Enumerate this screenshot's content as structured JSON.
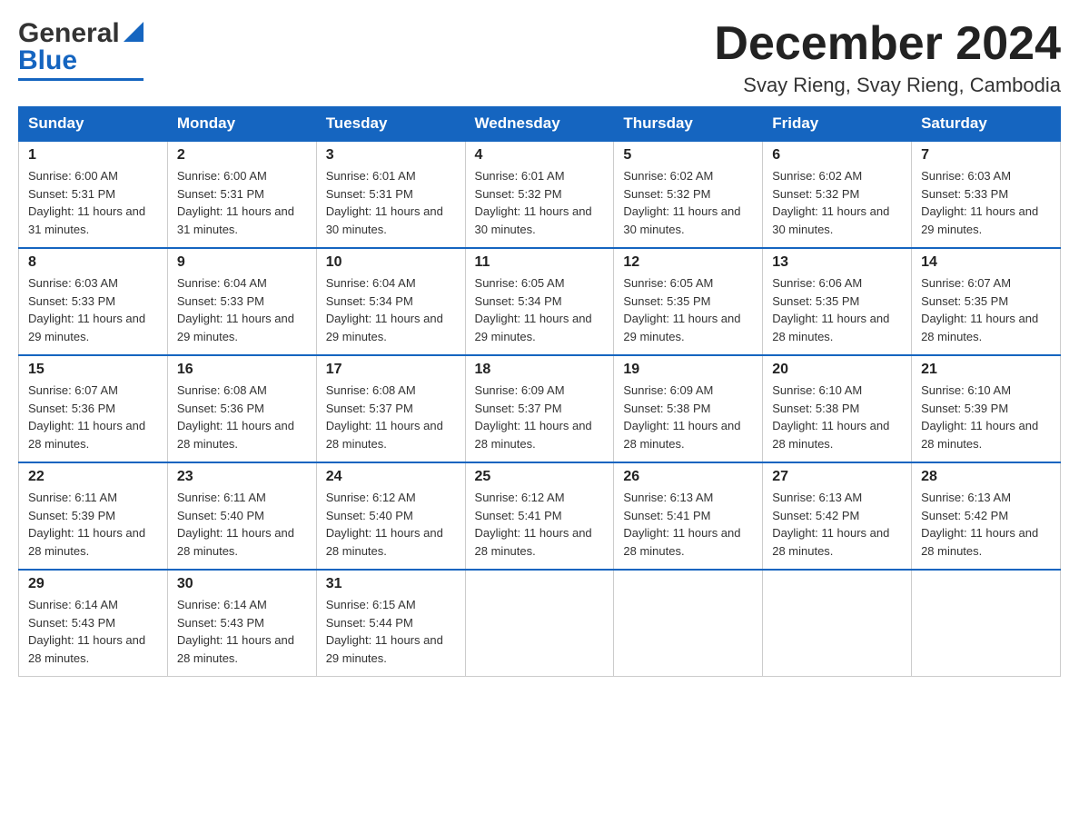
{
  "header": {
    "logo": {
      "general": "General",
      "blue": "Blue"
    },
    "title": "December 2024",
    "location": "Svay Rieng, Svay Rieng, Cambodia"
  },
  "weekdays": [
    "Sunday",
    "Monday",
    "Tuesday",
    "Wednesday",
    "Thursday",
    "Friday",
    "Saturday"
  ],
  "weeks": [
    [
      {
        "day": "1",
        "sunrise": "Sunrise: 6:00 AM",
        "sunset": "Sunset: 5:31 PM",
        "daylight": "Daylight: 11 hours and 31 minutes."
      },
      {
        "day": "2",
        "sunrise": "Sunrise: 6:00 AM",
        "sunset": "Sunset: 5:31 PM",
        "daylight": "Daylight: 11 hours and 31 minutes."
      },
      {
        "day": "3",
        "sunrise": "Sunrise: 6:01 AM",
        "sunset": "Sunset: 5:31 PM",
        "daylight": "Daylight: 11 hours and 30 minutes."
      },
      {
        "day": "4",
        "sunrise": "Sunrise: 6:01 AM",
        "sunset": "Sunset: 5:32 PM",
        "daylight": "Daylight: 11 hours and 30 minutes."
      },
      {
        "day": "5",
        "sunrise": "Sunrise: 6:02 AM",
        "sunset": "Sunset: 5:32 PM",
        "daylight": "Daylight: 11 hours and 30 minutes."
      },
      {
        "day": "6",
        "sunrise": "Sunrise: 6:02 AM",
        "sunset": "Sunset: 5:32 PM",
        "daylight": "Daylight: 11 hours and 30 minutes."
      },
      {
        "day": "7",
        "sunrise": "Sunrise: 6:03 AM",
        "sunset": "Sunset: 5:33 PM",
        "daylight": "Daylight: 11 hours and 29 minutes."
      }
    ],
    [
      {
        "day": "8",
        "sunrise": "Sunrise: 6:03 AM",
        "sunset": "Sunset: 5:33 PM",
        "daylight": "Daylight: 11 hours and 29 minutes."
      },
      {
        "day": "9",
        "sunrise": "Sunrise: 6:04 AM",
        "sunset": "Sunset: 5:33 PM",
        "daylight": "Daylight: 11 hours and 29 minutes."
      },
      {
        "day": "10",
        "sunrise": "Sunrise: 6:04 AM",
        "sunset": "Sunset: 5:34 PM",
        "daylight": "Daylight: 11 hours and 29 minutes."
      },
      {
        "day": "11",
        "sunrise": "Sunrise: 6:05 AM",
        "sunset": "Sunset: 5:34 PM",
        "daylight": "Daylight: 11 hours and 29 minutes."
      },
      {
        "day": "12",
        "sunrise": "Sunrise: 6:05 AM",
        "sunset": "Sunset: 5:35 PM",
        "daylight": "Daylight: 11 hours and 29 minutes."
      },
      {
        "day": "13",
        "sunrise": "Sunrise: 6:06 AM",
        "sunset": "Sunset: 5:35 PM",
        "daylight": "Daylight: 11 hours and 28 minutes."
      },
      {
        "day": "14",
        "sunrise": "Sunrise: 6:07 AM",
        "sunset": "Sunset: 5:35 PM",
        "daylight": "Daylight: 11 hours and 28 minutes."
      }
    ],
    [
      {
        "day": "15",
        "sunrise": "Sunrise: 6:07 AM",
        "sunset": "Sunset: 5:36 PM",
        "daylight": "Daylight: 11 hours and 28 minutes."
      },
      {
        "day": "16",
        "sunrise": "Sunrise: 6:08 AM",
        "sunset": "Sunset: 5:36 PM",
        "daylight": "Daylight: 11 hours and 28 minutes."
      },
      {
        "day": "17",
        "sunrise": "Sunrise: 6:08 AM",
        "sunset": "Sunset: 5:37 PM",
        "daylight": "Daylight: 11 hours and 28 minutes."
      },
      {
        "day": "18",
        "sunrise": "Sunrise: 6:09 AM",
        "sunset": "Sunset: 5:37 PM",
        "daylight": "Daylight: 11 hours and 28 minutes."
      },
      {
        "day": "19",
        "sunrise": "Sunrise: 6:09 AM",
        "sunset": "Sunset: 5:38 PM",
        "daylight": "Daylight: 11 hours and 28 minutes."
      },
      {
        "day": "20",
        "sunrise": "Sunrise: 6:10 AM",
        "sunset": "Sunset: 5:38 PM",
        "daylight": "Daylight: 11 hours and 28 minutes."
      },
      {
        "day": "21",
        "sunrise": "Sunrise: 6:10 AM",
        "sunset": "Sunset: 5:39 PM",
        "daylight": "Daylight: 11 hours and 28 minutes."
      }
    ],
    [
      {
        "day": "22",
        "sunrise": "Sunrise: 6:11 AM",
        "sunset": "Sunset: 5:39 PM",
        "daylight": "Daylight: 11 hours and 28 minutes."
      },
      {
        "day": "23",
        "sunrise": "Sunrise: 6:11 AM",
        "sunset": "Sunset: 5:40 PM",
        "daylight": "Daylight: 11 hours and 28 minutes."
      },
      {
        "day": "24",
        "sunrise": "Sunrise: 6:12 AM",
        "sunset": "Sunset: 5:40 PM",
        "daylight": "Daylight: 11 hours and 28 minutes."
      },
      {
        "day": "25",
        "sunrise": "Sunrise: 6:12 AM",
        "sunset": "Sunset: 5:41 PM",
        "daylight": "Daylight: 11 hours and 28 minutes."
      },
      {
        "day": "26",
        "sunrise": "Sunrise: 6:13 AM",
        "sunset": "Sunset: 5:41 PM",
        "daylight": "Daylight: 11 hours and 28 minutes."
      },
      {
        "day": "27",
        "sunrise": "Sunrise: 6:13 AM",
        "sunset": "Sunset: 5:42 PM",
        "daylight": "Daylight: 11 hours and 28 minutes."
      },
      {
        "day": "28",
        "sunrise": "Sunrise: 6:13 AM",
        "sunset": "Sunset: 5:42 PM",
        "daylight": "Daylight: 11 hours and 28 minutes."
      }
    ],
    [
      {
        "day": "29",
        "sunrise": "Sunrise: 6:14 AM",
        "sunset": "Sunset: 5:43 PM",
        "daylight": "Daylight: 11 hours and 28 minutes."
      },
      {
        "day": "30",
        "sunrise": "Sunrise: 6:14 AM",
        "sunset": "Sunset: 5:43 PM",
        "daylight": "Daylight: 11 hours and 28 minutes."
      },
      {
        "day": "31",
        "sunrise": "Sunrise: 6:15 AM",
        "sunset": "Sunset: 5:44 PM",
        "daylight": "Daylight: 11 hours and 29 minutes."
      },
      null,
      null,
      null,
      null
    ]
  ]
}
